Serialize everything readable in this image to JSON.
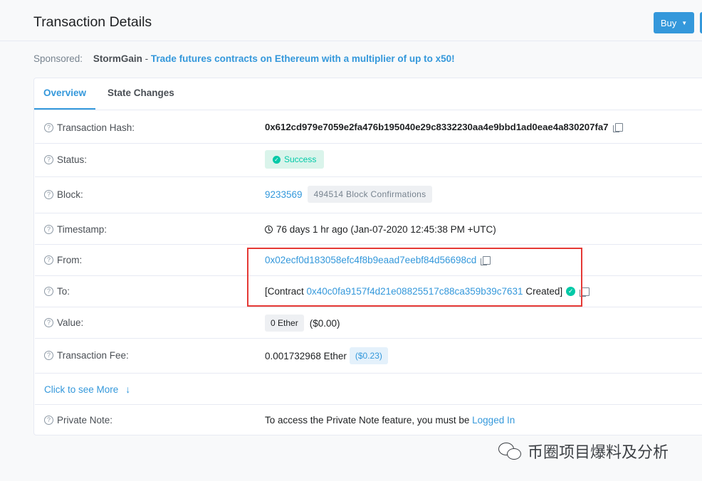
{
  "header": {
    "title": "Transaction Details",
    "buy_label": "Buy"
  },
  "sponsored": {
    "label": "Sponsored:",
    "name": "StormGain",
    "separator": " - ",
    "link_text": "Trade futures contracts on Ethereum with a multiplier of up to x50!"
  },
  "tabs": [
    {
      "label": "Overview",
      "active": true
    },
    {
      "label": "State Changes",
      "active": false
    }
  ],
  "rows": {
    "tx_hash": {
      "label": "Transaction Hash:",
      "value": "0x612cd979e7059e2fa476b195040e29c8332230aa4e9bbd1ad0eae4a830207fa7"
    },
    "status": {
      "label": "Status:",
      "value": "Success"
    },
    "block": {
      "label": "Block:",
      "value": "9233569",
      "confirmations": "494514 Block Confirmations"
    },
    "timestamp": {
      "label": "Timestamp:",
      "value": "76 days 1 hr ago (Jan-07-2020 12:45:38 PM +UTC)"
    },
    "from": {
      "label": "From:",
      "value": "0x02ecf0d183058efc4f8b9eaad7eebf84d56698cd"
    },
    "to": {
      "label": "To:",
      "prefix": "[Contract ",
      "address": "0x40c0fa9157f4d21e08825517c88ca359b39c7631",
      "suffix": " Created]"
    },
    "value": {
      "label": "Value:",
      "amount": "0 Ether",
      "usd": "($0.00)"
    },
    "fee": {
      "label": "Transaction Fee:",
      "amount": "0.001732968 Ether",
      "usd": "($0.23)"
    },
    "see_more": {
      "label": "Click to see More"
    },
    "private_note": {
      "label": "Private Note:",
      "text": "To access the Private Note feature, you must be ",
      "link": "Logged In"
    }
  },
  "watermark": {
    "text": "币圈项目爆料及分析"
  },
  "colors": {
    "accent": "#3498db",
    "success": "#00c9a7",
    "highlight": "#e53935"
  }
}
